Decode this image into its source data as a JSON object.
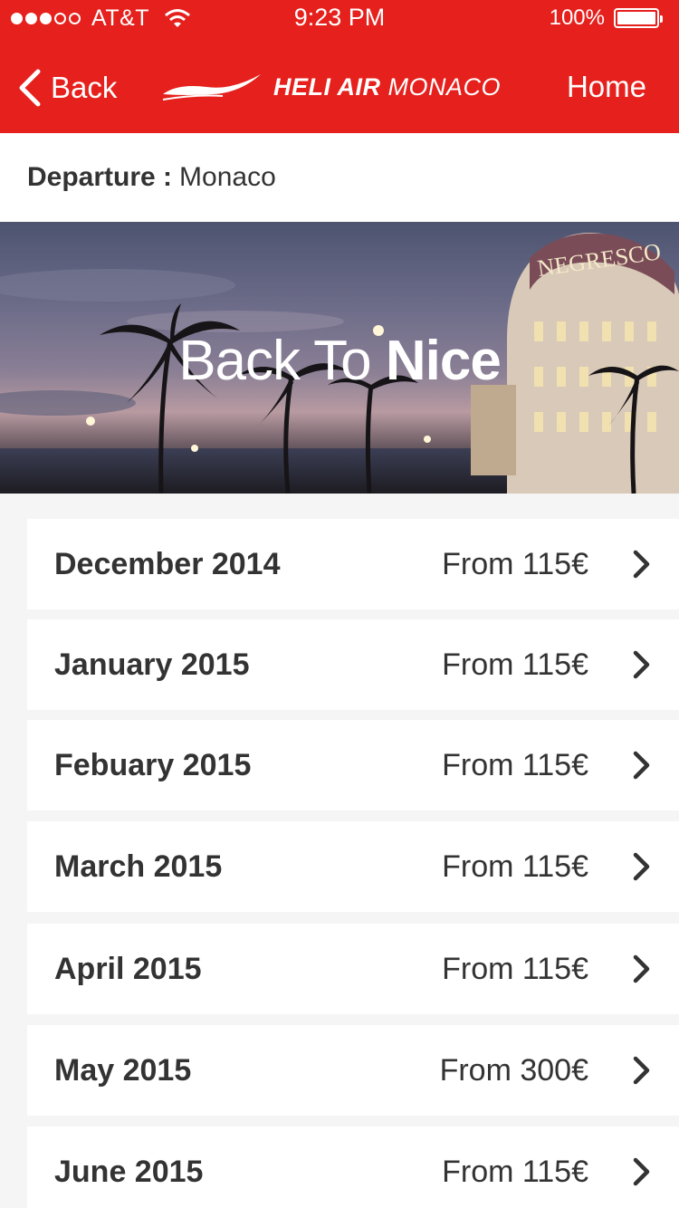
{
  "status_bar": {
    "carrier": "AT&T",
    "time": "9:23 PM",
    "battery": "100%"
  },
  "nav": {
    "back_label": "Back",
    "brand_bold": "HELI AIR",
    "brand_light": "MONACO",
    "home_label": "Home"
  },
  "departure": {
    "label": "Departure :",
    "value": "Monaco"
  },
  "hero": {
    "title_light": "Back To",
    "title_bold": "Nice",
    "sign_text": "NEGRESCO"
  },
  "months": [
    {
      "name": "December 2014",
      "price": "From 115€"
    },
    {
      "name": "January 2015",
      "price": "From 115€"
    },
    {
      "name": "Febuary 2015",
      "price": "From 115€"
    },
    {
      "name": "March 2015",
      "price": "From 115€"
    },
    {
      "name": "April 2015",
      "price": "From 115€"
    },
    {
      "name": "May 2015",
      "price": "From 300€"
    },
    {
      "name": "June 2015",
      "price": "From 115€"
    }
  ],
  "colors": {
    "brand_red": "#e6201c",
    "text_dark": "#333333",
    "list_background": "#f5f5f5"
  }
}
